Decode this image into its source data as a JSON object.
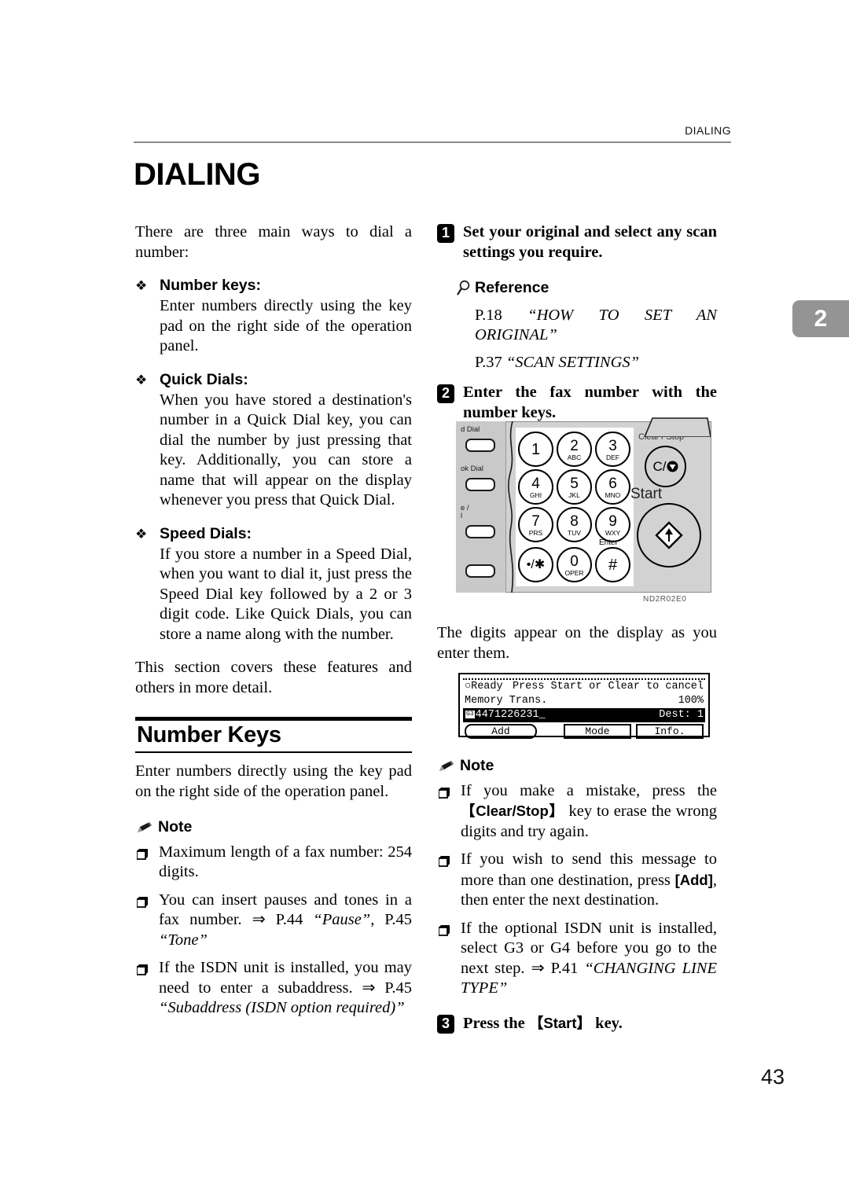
{
  "running_head": "DIALING",
  "chapter_tab": "2",
  "page_number": "43",
  "title": "DIALING",
  "left_column": {
    "intro": "There are three main ways to dial a number:",
    "bullets": [
      {
        "marker": "❖",
        "title": "Number keys:",
        "text": "Enter numbers directly using the key pad on the right side of the operation panel."
      },
      {
        "marker": "❖",
        "title": "Quick Dials:",
        "text": "When you have stored a destination's number in a Quick Dial key, you can dial the number by just pressing that key. Additionally, you can store a name that will appear on the display whenever you press that Quick Dial."
      },
      {
        "marker": "❖",
        "title": "Speed Dials:",
        "text": "If you store a number in a Speed Dial, when you want to dial it, just press the Speed Dial key followed by a 2 or 3 digit code. Like Quick Dials, you can store a name along with the number."
      }
    ],
    "closing": "This section covers these features and others in more detail.",
    "section_heading": "Number Keys",
    "section_intro": "Enter numbers directly using the key pad on the right side of the operation panel.",
    "note_label": "Note",
    "note_icon": "pencil-icon",
    "notes": [
      {
        "marker": "❑",
        "parts": [
          {
            "t": "Maximum length of a fax number: 254 digits.",
            "style": "normal"
          }
        ]
      },
      {
        "marker": "❑",
        "parts": [
          {
            "t": "You can insert pauses and tones in a fax number. ⇒ P.44 ",
            "style": "normal"
          },
          {
            "t": "“Pause”",
            "style": "italic"
          },
          {
            "t": ", P.45 ",
            "style": "normal"
          },
          {
            "t": "“Tone”",
            "style": "italic"
          }
        ]
      },
      {
        "marker": "❑",
        "parts": [
          {
            "t": "If the ISDN unit is installed, you may need to enter a subaddress. ⇒ P.45 ",
            "style": "normal"
          },
          {
            "t": "“Subaddress (ISDN option required)”",
            "style": "italic"
          }
        ]
      }
    ]
  },
  "right_column": {
    "step1": {
      "num": "1",
      "text": "Set your original and select any scan settings you require."
    },
    "reference_label": "Reference",
    "reference_icon": "magnifier-icon",
    "references": [
      {
        "page": "P.18 ",
        "title": "“HOW TO SET AN ORIGINAL”"
      },
      {
        "page": "P.37 ",
        "title": "“SCAN SETTINGS”"
      }
    ],
    "step2": {
      "num": "2",
      "text": "Enter the fax number with the number keys."
    },
    "after_figure": "The digits appear on the display as you enter them.",
    "note_label": "Note",
    "note_icon": "pencil-icon",
    "notes": [
      {
        "marker": "❑",
        "parts": [
          {
            "t": "If you make a mistake, press the ",
            "style": "normal"
          },
          {
            "t": "【Clear/Stop】",
            "style": "key"
          },
          {
            "t": " key to erase the wrong digits and try again.",
            "style": "normal"
          }
        ]
      },
      {
        "marker": "❑",
        "parts": [
          {
            "t": "If you wish to send this message to more than one destination, press ",
            "style": "normal"
          },
          {
            "t": "[Add]",
            "style": "key"
          },
          {
            "t": ", then enter the next destination.",
            "style": "normal"
          }
        ]
      },
      {
        "marker": "❑",
        "parts": [
          {
            "t": "If the optional ISDN unit is installed, select G3 or G4 before you go to the next step. ⇒ P.41 ",
            "style": "normal"
          },
          {
            "t": "“CHANGING LINE TYPE”",
            "style": "italic"
          }
        ]
      }
    ],
    "step3": {
      "num": "3",
      "pre": "Press the ",
      "key": "【Start】",
      "post": " key."
    }
  },
  "figure": {
    "caption_code": "ND2R02E0",
    "side_labels": [
      "d Dial",
      "ok Dial",
      "e /",
      "l"
    ],
    "keys": [
      {
        "digit": "1",
        "letters": ""
      },
      {
        "digit": "2",
        "letters": "ABC"
      },
      {
        "digit": "3",
        "letters": "DEF"
      },
      {
        "digit": "4",
        "letters": "GHI"
      },
      {
        "digit": "5",
        "letters": "JKL"
      },
      {
        "digit": "6",
        "letters": "MNO"
      },
      {
        "digit": "7",
        "letters": "PRS"
      },
      {
        "digit": "8",
        "letters": "TUV"
      },
      {
        "digit": "9",
        "letters": "WXY"
      },
      {
        "digit": "•/✱",
        "letters": ""
      },
      {
        "digit": "0",
        "letters": "OPER"
      },
      {
        "digit": "#",
        "letters": ""
      }
    ],
    "enter_label": "Enter",
    "clear_stop_label": "Clear / Stop",
    "clear_stop_key": "C/",
    "start_label": "Start"
  },
  "lcd": {
    "status_left": "○Ready",
    "status_right": "Press Start or Clear to cancel",
    "mode_left": "Memory Trans.",
    "mode_right": "100%",
    "number": "4471226231_",
    "dest_label": "Dest:",
    "dest_count": "1",
    "buttons": [
      "Add",
      "Mode",
      "Info."
    ]
  }
}
